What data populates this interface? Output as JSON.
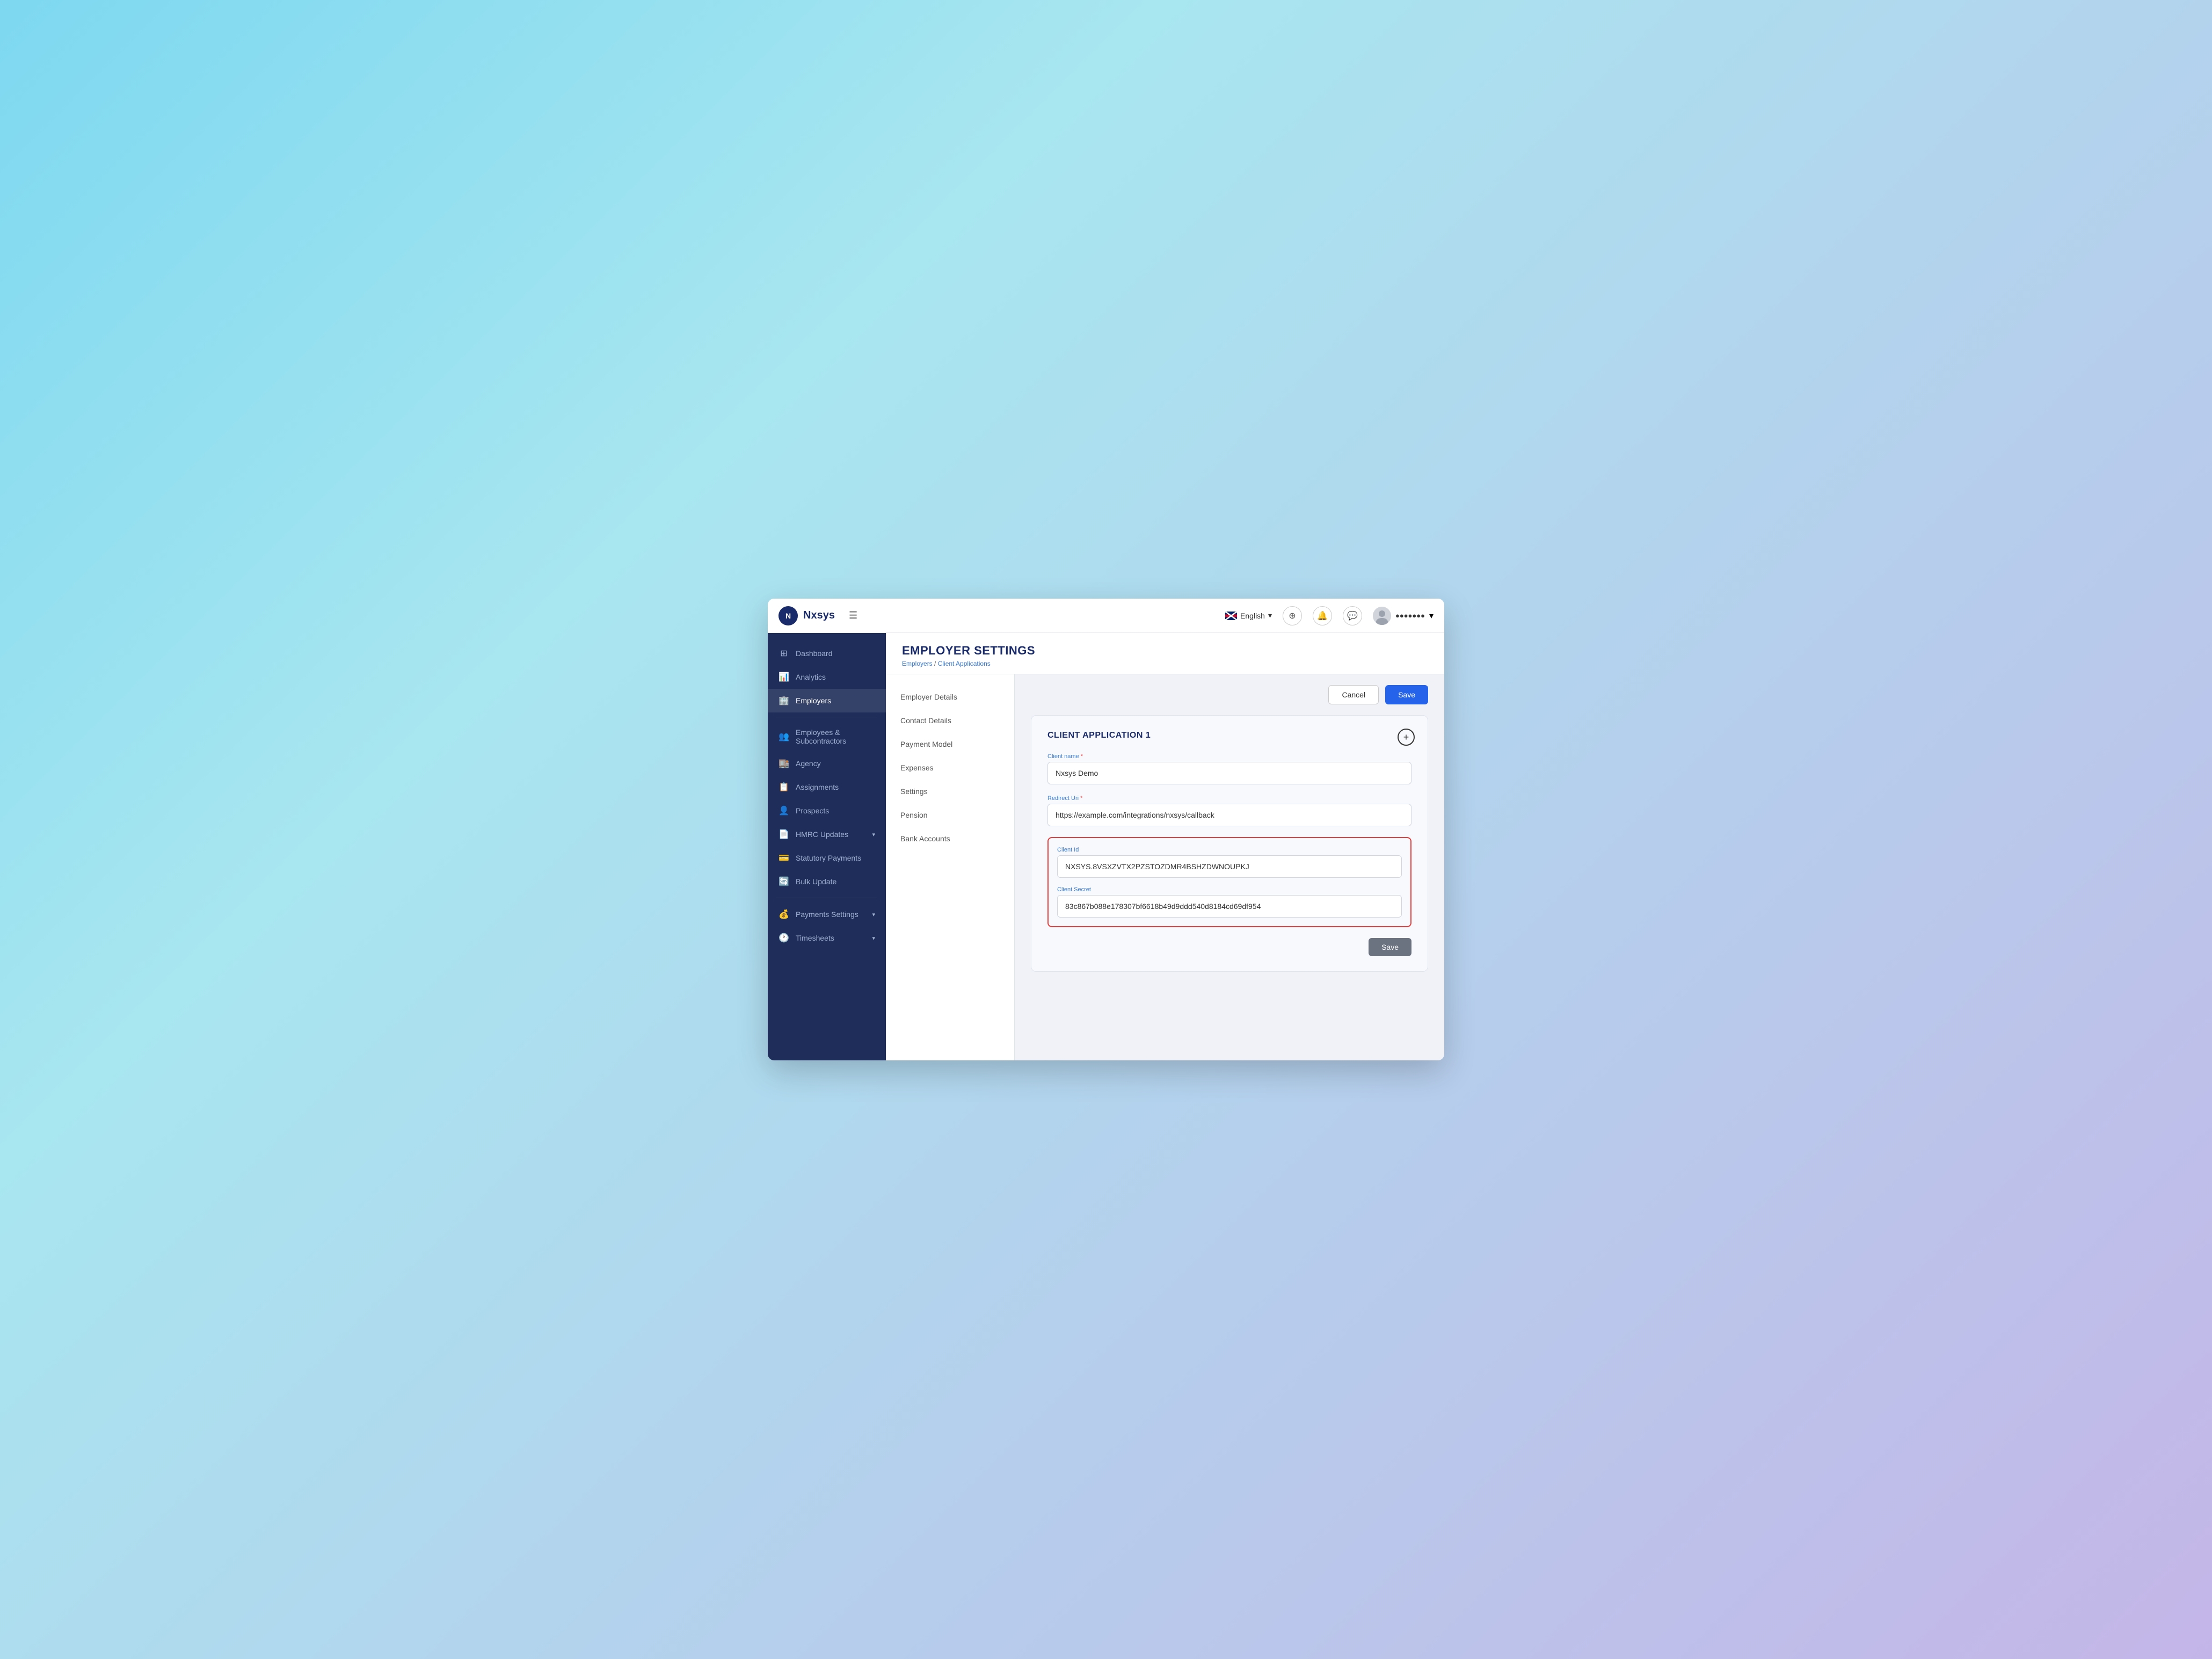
{
  "header": {
    "logo_text": "Nxsys",
    "logo_initial": "N",
    "language": "English",
    "username": "●●●●●●●"
  },
  "sidebar": {
    "items": [
      {
        "id": "dashboard",
        "label": "Dashboard",
        "icon": "⊞"
      },
      {
        "id": "analytics",
        "label": "Analytics",
        "icon": "📊"
      },
      {
        "id": "employers",
        "label": "Employers",
        "icon": "🏢",
        "active": true
      },
      {
        "id": "divider1",
        "type": "divider"
      },
      {
        "id": "employees",
        "label": "Employees & Subcontractors",
        "icon": "👥"
      },
      {
        "id": "agency",
        "label": "Agency",
        "icon": "🏬"
      },
      {
        "id": "assignments",
        "label": "Assignments",
        "icon": "📋"
      },
      {
        "id": "prospects",
        "label": "Prospects",
        "icon": "👤"
      },
      {
        "id": "hmrc",
        "label": "HMRC Updates",
        "icon": "📄",
        "hasArrow": true
      },
      {
        "id": "statutory",
        "label": "Statutory Payments",
        "icon": "💳"
      },
      {
        "id": "bulk",
        "label": "Bulk Update",
        "icon": "🔄"
      },
      {
        "id": "divider2",
        "type": "divider"
      },
      {
        "id": "payments",
        "label": "Payments Settings",
        "icon": "💰",
        "hasArrow": true
      },
      {
        "id": "timesheets",
        "label": "Timesheets",
        "icon": "🕐",
        "hasArrow": true
      }
    ]
  },
  "page": {
    "title": "EMPLOYER SETTINGS",
    "breadcrumb_parent": "Employers",
    "breadcrumb_current": "Client Applications"
  },
  "sub_nav": {
    "items": [
      {
        "id": "employer-details",
        "label": "Employer Details"
      },
      {
        "id": "contact-details",
        "label": "Contact Details"
      },
      {
        "id": "payment-model",
        "label": "Payment Model"
      },
      {
        "id": "expenses",
        "label": "Expenses"
      },
      {
        "id": "settings",
        "label": "Settings"
      },
      {
        "id": "pension",
        "label": "Pension"
      },
      {
        "id": "bank-accounts",
        "label": "Bank Accounts"
      }
    ]
  },
  "actions": {
    "cancel_label": "Cancel",
    "save_label": "Save"
  },
  "client_application": {
    "title": "CLIENT APPLICATION 1",
    "fields": {
      "client_name_label": "Client name",
      "client_name_value": "Nxsys Demo",
      "redirect_uri_label": "Redirect Uri",
      "redirect_uri_value": "https://example.com/integrations/nxsys/callback",
      "client_id_label": "Client Id",
      "client_id_value": "NXSYS.8VSXZVTX2PZSTOZDMR4BSHZDWNOUPKJ",
      "client_secret_label": "Client Secret",
      "client_secret_value": "83c867b088e178307bf6618b49d9ddd540d8184cd69df954"
    },
    "save_label": "Save"
  }
}
